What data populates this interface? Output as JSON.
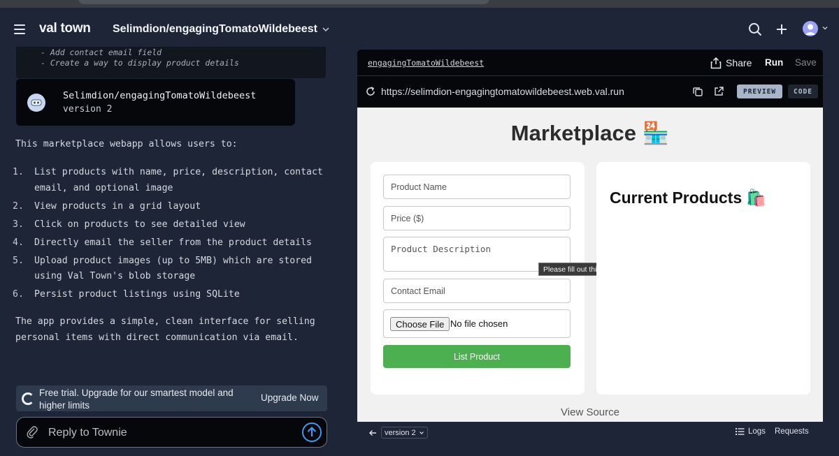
{
  "header": {
    "logo": "val town",
    "val_name": "Selimdion/engagingTomatoWildebeest"
  },
  "chat": {
    "code_lines": [
      "- Add contact email field",
      "- Create a way to display product details"
    ],
    "val_card": {
      "title": "Selimdion/engagingTomatoWildebeest",
      "version": "version 2"
    },
    "intro": "This marketplace webapp allows users to:",
    "features": [
      {
        "num": "1.",
        "text": "List products with name, price, description, contact email, and optional image"
      },
      {
        "num": "2.",
        "text": "View products in a grid layout"
      },
      {
        "num": "3.",
        "text": "Click on products to see detailed view"
      },
      {
        "num": "4.",
        "text": "Directly email the seller from the product details"
      },
      {
        "num": "5.",
        "text": "Upload product images (up to 5MB) which are stored using Val Town's blob storage"
      },
      {
        "num": "6.",
        "text": "Persist product listings using SQLite"
      }
    ],
    "outro": "The app provides a simple, clean interface for selling personal items with direct communication via email.",
    "trial_text": "Free trial. Upgrade for our smartest model and higher limits",
    "upgrade_label": "Upgrade Now",
    "reply_placeholder": "Reply to Townie"
  },
  "preview": {
    "val_link": "engagingTomatoWildebeest",
    "share_label": "Share",
    "run_label": "Run",
    "save_label": "Save",
    "url": "https://selimdion-engagingtomatowildebeest.web.val.run",
    "preview_toggle": "PREVIEW",
    "code_toggle": "CODE",
    "version_label": "version 2",
    "logs_label": "Logs",
    "requests_label": "Requests"
  },
  "app": {
    "title": "Marketplace",
    "title_emoji": "🏪",
    "name_placeholder": "Product Name",
    "price_placeholder": "Price ($)",
    "description_placeholder": "Product Description",
    "email_placeholder": "Contact Email",
    "choose_file_label": "Choose File",
    "no_file_label": "No file chosen",
    "submit_label": "List Product",
    "tooltip": "Please fill out this field.",
    "products_title": "Current Products",
    "products_emoji": "🛍️",
    "view_source": "View Source"
  },
  "colors": {
    "background": "#1d2536",
    "submit_button": "#4caf50",
    "link_accent": "#3b9af0"
  }
}
